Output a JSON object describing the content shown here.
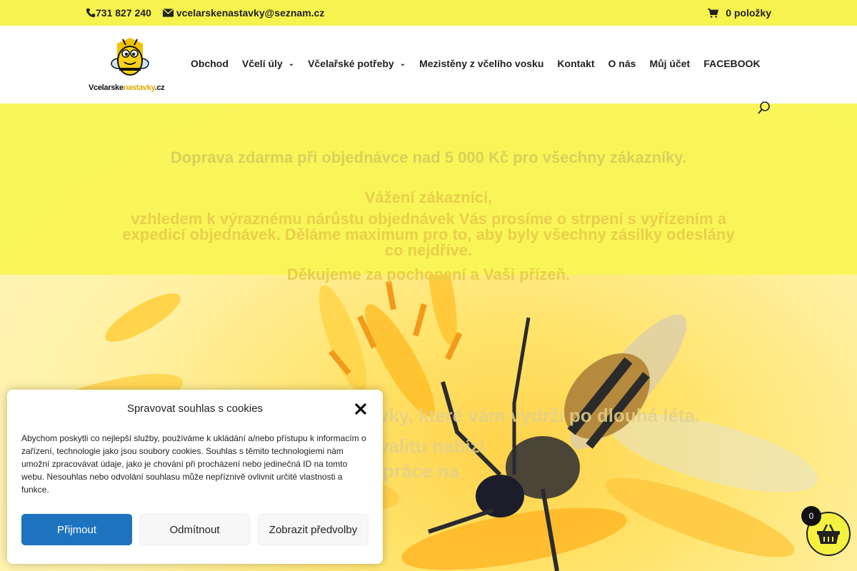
{
  "topbar": {
    "phone": "731 827 240",
    "email": "vcelarskenastavky@seznam.cz",
    "cart_label": "0 položky"
  },
  "logo": {
    "text_a": "Vcelarske",
    "text_b": "nastavky",
    "text_c": ".cz"
  },
  "nav": {
    "items": [
      {
        "label": "Obchod",
        "has_dropdown": false
      },
      {
        "label": "Včelí úly",
        "has_dropdown": true
      },
      {
        "label": "Včelařské potřeby",
        "has_dropdown": true
      },
      {
        "label": "Mezistěny z včelího vosku",
        "has_dropdown": false
      },
      {
        "label": "Kontakt",
        "has_dropdown": false
      },
      {
        "label": "O nás",
        "has_dropdown": false
      },
      {
        "label": "Můj účet",
        "has_dropdown": false
      },
      {
        "label": "FACEBOOK",
        "has_dropdown": false
      }
    ]
  },
  "hero": {
    "shipping": "Doprava zdarma při objednávce nad 5 000 Kč pro všechny zákazníky.",
    "greeting": "Vážení zákazníci,",
    "notice": "vzhledem k výraznému nárůstu objednávek Vás prosíme o strpení s vyřízením a expedicí objednávek. Děláme maximum pro to, aby byly všechny zásilky odeslány co nejdříve.",
    "thanks": "Děkujeme za pochopení a Vaši přízeň.",
    "sub1": "vky, které vám vydrží po dlouhá léta.",
    "sub2": "valitu nabízí",
    "sub3": "práce na"
  },
  "cookie": {
    "title": "Spravovat souhlas s cookies",
    "text": "Abychom poskytli co nejlepší služby, používáme k ukládání a/nebo přístupu k informacím o zařízení, technologie jako jsou soubory cookies. Souhlas s těmito technologiemi nám umožní zpracovávat údaje, jako je chování při procházení nebo jedinečná ID na tomto webu. Nesouhlas nebo odvolání souhlasu může nepříznivě ovlivnit určité vlastnosti a funkce.",
    "accept": "Přijmout",
    "deny": "Odmítnout",
    "prefs": "Zobrazit předvolby"
  },
  "floating_cart": {
    "count": "0"
  },
  "colors": {
    "brand_yellow": "#f6f34f",
    "accept_blue": "#1e73be"
  }
}
